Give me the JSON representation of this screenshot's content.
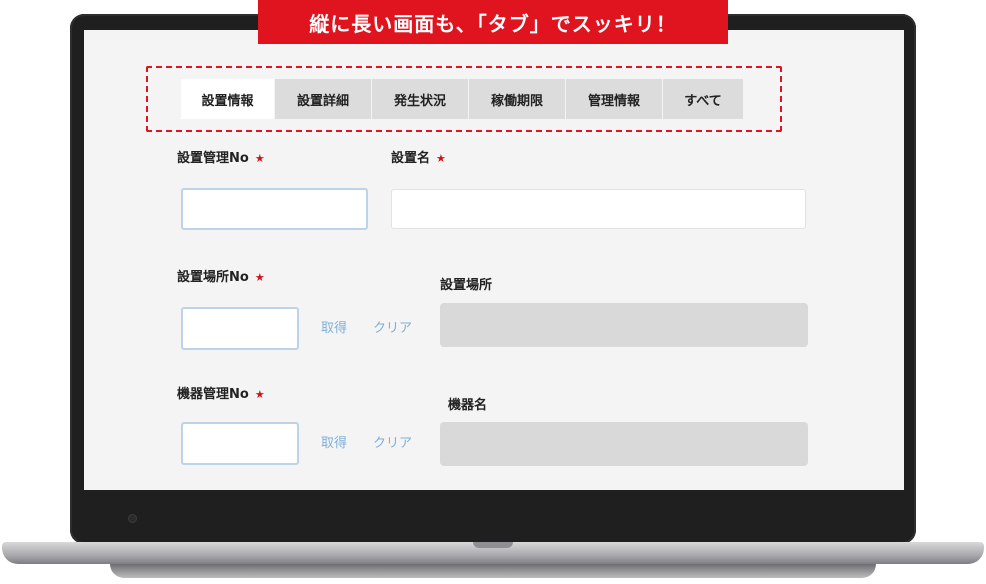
{
  "banner": {
    "text": "縦に長い画面も、「タブ」でスッキリ！"
  },
  "tabs": [
    {
      "label": "設置情報",
      "active": true
    },
    {
      "label": "設置詳細",
      "active": false
    },
    {
      "label": "発生状況",
      "active": false
    },
    {
      "label": "稼働期限",
      "active": false
    },
    {
      "label": "管理情報",
      "active": false
    },
    {
      "label": "すべて",
      "active": false
    }
  ],
  "required_mark": "★",
  "form": {
    "install_mgmt_no": {
      "label": "設置管理No",
      "value": "",
      "required": true
    },
    "install_name": {
      "label": "設置名",
      "value": "",
      "required": true
    },
    "location_no": {
      "label": "設置場所No",
      "value": "",
      "required": true
    },
    "location": {
      "label": "設置場所",
      "value": ""
    },
    "device_mgmt_no": {
      "label": "機器管理No",
      "value": "",
      "required": true
    },
    "device_name": {
      "label": "機器名",
      "value": ""
    }
  },
  "actions": {
    "fetch": "取得",
    "clear": "クリア"
  },
  "colors": {
    "banner": "#e0141e",
    "required": "#d0121b",
    "link": "#7fb0d8",
    "focus_border": "#bcd3ea"
  }
}
